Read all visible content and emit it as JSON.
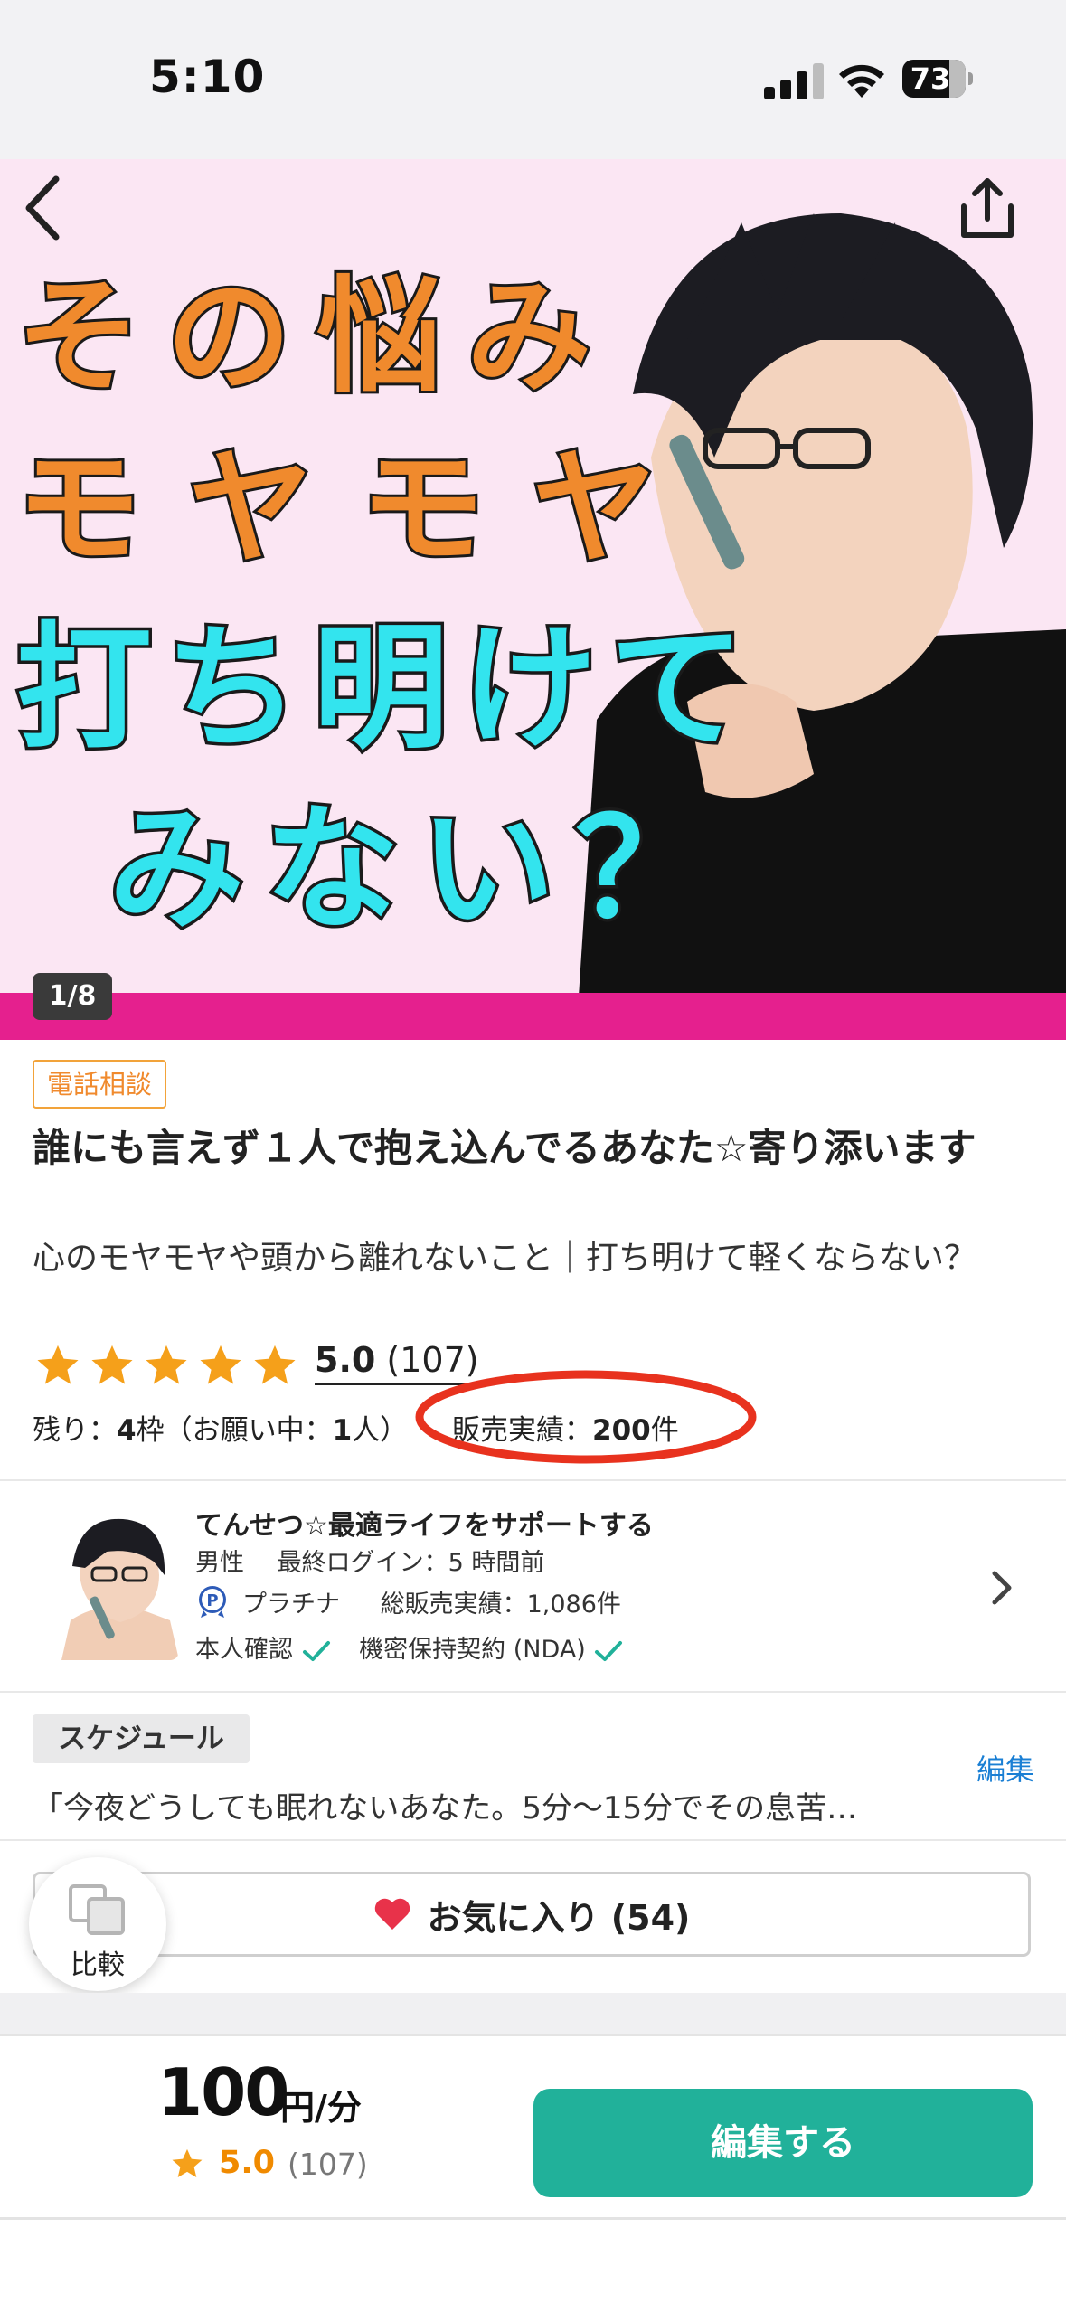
{
  "status_bar": {
    "time": "5:10",
    "battery": "73"
  },
  "hero": {
    "lines": [
      "その悩み",
      "モヤモヤ",
      "打ち明けて",
      "みない？"
    ],
    "page_counter": "1/8"
  },
  "listing": {
    "category": "電話相談",
    "title": "誰にも言えず１人で抱え込んでるあなた☆寄り添います",
    "subtitle": "心のモヤモヤや頭から離れないこと｜打ち明けて軽くならない？",
    "rating": "5.0",
    "review_count": "(107)",
    "stars": 5,
    "stock_prefix": "残り：",
    "stock_slots": "4",
    "stock_unit": "枠（お願い中：",
    "stock_pending": "1",
    "stock_suffix": "人）",
    "sales_label": "販売実績：",
    "sales_value": "200",
    "sales_unit": "件"
  },
  "seller": {
    "name": "てんせつ☆最適ライフをサポートする",
    "gender": "男性",
    "last_login": "最終ログイン：5 時間前",
    "rank": "プラチナ",
    "total_sales": "総販売実績：1,086件",
    "identity_verified": "本人確認",
    "nda": "機密保持契約 (NDA)"
  },
  "schedule": {
    "label": "スケジュール",
    "edit": "編集",
    "text": "「今夜どうしても眠れないあなた。5分〜15分でその息苦…"
  },
  "favorite": {
    "label": "お気に入り (54)"
  },
  "compare": {
    "label": "比較"
  },
  "bottom": {
    "price": "100",
    "price_unit": "円/分",
    "rating": "5.0",
    "review_count": "(107)",
    "cta": "編集する"
  },
  "colors": {
    "accent_green": "#21b19a",
    "hero_pink": "#fbe6f3",
    "stripe_magenta": "#e5208e",
    "star_orange": "#f5a01a",
    "link_blue": "#1a7fd4"
  },
  "icons": [
    "back-chevron-icon",
    "share-icon",
    "star-icon",
    "platinum-badge-icon",
    "check-icon",
    "chevron-right-icon",
    "heart-icon",
    "compare-icon"
  ]
}
